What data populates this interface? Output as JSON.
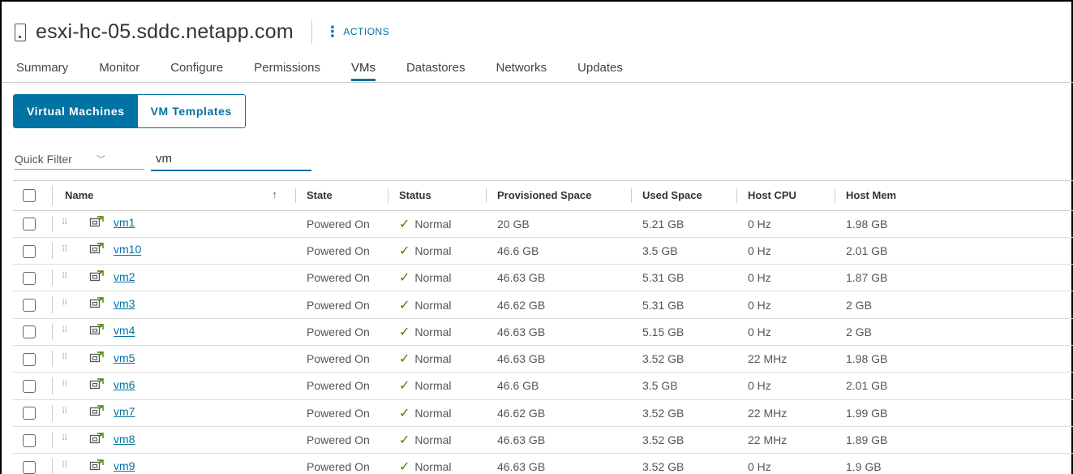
{
  "header": {
    "title": "esxi-hc-05.sddc.netapp.com",
    "actions_label": "ACTIONS"
  },
  "tabs": [
    {
      "label": "Summary",
      "active": false
    },
    {
      "label": "Monitor",
      "active": false
    },
    {
      "label": "Configure",
      "active": false
    },
    {
      "label": "Permissions",
      "active": false
    },
    {
      "label": "VMs",
      "active": true
    },
    {
      "label": "Datastores",
      "active": false
    },
    {
      "label": "Networks",
      "active": false
    },
    {
      "label": "Updates",
      "active": false
    }
  ],
  "segments": {
    "virtual_machines": "Virtual Machines",
    "vm_templates": "VM Templates"
  },
  "filter": {
    "quick_filter_label": "Quick Filter",
    "value": "vm"
  },
  "columns": {
    "name": "Name",
    "sort_indicator": "↑",
    "state": "State",
    "status": "Status",
    "provisioned": "Provisioned Space",
    "used": "Used Space",
    "cpu": "Host CPU",
    "mem": "Host Mem"
  },
  "rows": [
    {
      "name": "vm1",
      "state": "Powered On",
      "status": "Normal",
      "provisioned": "20 GB",
      "used": "5.21 GB",
      "cpu": "0 Hz",
      "mem": "1.98 GB"
    },
    {
      "name": "vm10",
      "state": "Powered On",
      "status": "Normal",
      "provisioned": "46.6 GB",
      "used": "3.5 GB",
      "cpu": "0 Hz",
      "mem": "2.01 GB"
    },
    {
      "name": "vm2",
      "state": "Powered On",
      "status": "Normal",
      "provisioned": "46.63 GB",
      "used": "5.31 GB",
      "cpu": "0 Hz",
      "mem": "1.87 GB"
    },
    {
      "name": "vm3",
      "state": "Powered On",
      "status": "Normal",
      "provisioned": "46.62 GB",
      "used": "5.31 GB",
      "cpu": "0 Hz",
      "mem": "2 GB"
    },
    {
      "name": "vm4",
      "state": "Powered On",
      "status": "Normal",
      "provisioned": "46.63 GB",
      "used": "5.15 GB",
      "cpu": "0 Hz",
      "mem": "2 GB"
    },
    {
      "name": "vm5",
      "state": "Powered On",
      "status": "Normal",
      "provisioned": "46.63 GB",
      "used": "3.52 GB",
      "cpu": "22 MHz",
      "mem": "1.98 GB"
    },
    {
      "name": "vm6",
      "state": "Powered On",
      "status": "Normal",
      "provisioned": "46.6 GB",
      "used": "3.5 GB",
      "cpu": "0 Hz",
      "mem": "2.01 GB"
    },
    {
      "name": "vm7",
      "state": "Powered On",
      "status": "Normal",
      "provisioned": "46.62 GB",
      "used": "3.52 GB",
      "cpu": "22 MHz",
      "mem": "1.99 GB"
    },
    {
      "name": "vm8",
      "state": "Powered On",
      "status": "Normal",
      "provisioned": "46.63 GB",
      "used": "3.52 GB",
      "cpu": "22 MHz",
      "mem": "1.89 GB"
    },
    {
      "name": "vm9",
      "state": "Powered On",
      "status": "Normal",
      "provisioned": "46.63 GB",
      "used": "3.52 GB",
      "cpu": "0 Hz",
      "mem": "1.9 GB"
    }
  ],
  "colors": {
    "accent": "#0072a3",
    "status_ok": "#3c8500"
  },
  "icons": {
    "host": "host-icon",
    "vm": "vm-powered-on-icon",
    "status_ok": "check-icon"
  }
}
